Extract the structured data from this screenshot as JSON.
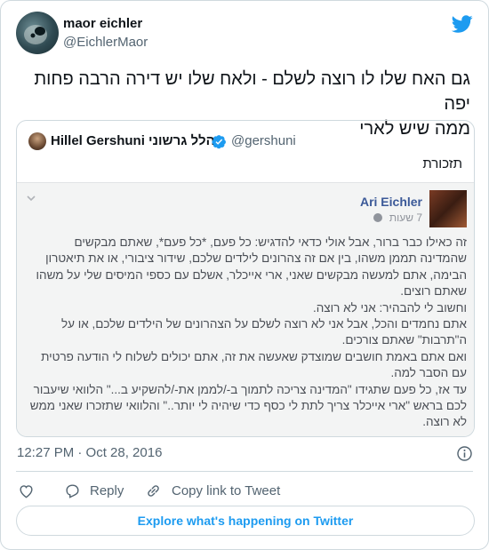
{
  "author": {
    "name": "maor eichler",
    "handle": "@EichlerMaor",
    "avatar_icon": "avatar-image"
  },
  "tweet": {
    "text_line1": "גם האח שלו לו רוצה לשלם - ולאח שלו יש דירה הרבה פחות יפה",
    "text_line2": "ממה שיש לארי"
  },
  "quote": {
    "name": "Hillel Gershuni הלל גרשוני",
    "handle": "@gershuni",
    "text": "תזכורת",
    "facebook_post": {
      "author": "Ari Eichler",
      "time": "7 שעות",
      "paragraphs": [
        "זה כאילו כבר ברור, אבל אולי כדאי להדגיש: כל פעם, *כל פעם*, שאתם מבקשים שהמדינה תממן משהו, בין אם זה צהרונים לילדים שלכם, שידור ציבורי, או את תיאטרון הבימה, אתם למעשה מבקשים שאני, ארי אייכלר, אשלם עם כספי המיסים שלי על משהו שאתם רוצים.",
        "וחשוב לי להבהיר: אני לא רוצה.",
        "אתם נחמדים והכל, אבל אני לא רוצה לשלם על הצהרונים של הילדים שלכם, או על ה\"תרבות\" שאתם צורכים.",
        "ואם אתם באמת חושבים שמוצדק שאעשה את זה, אתם יכולים לשלוח לי הודעה פרטית עם הסבר למה.",
        "עד אז, כל פעם שתגידו \"המדינה צריכה לתמוך ב-/לממן את-/להשקיע ב...\" הלוואי שיעבור לכם בראש \"ארי אייכלר צריך לתת לי כסף כדי שיהיה לי יותר..\" והלוואי שתזכרו שאני ממש לא רוצה."
      ]
    }
  },
  "meta": {
    "timestamp": "12:27 PM · Oct 28, 2016"
  },
  "actions": {
    "reply_label": "Reply",
    "copy_label": "Copy link to Tweet"
  },
  "explore": {
    "label": "Explore what's happening on Twitter"
  },
  "colors": {
    "twitter_blue": "#1d9bf0",
    "facebook_blue": "#3b5998",
    "text_secondary": "#536471"
  }
}
